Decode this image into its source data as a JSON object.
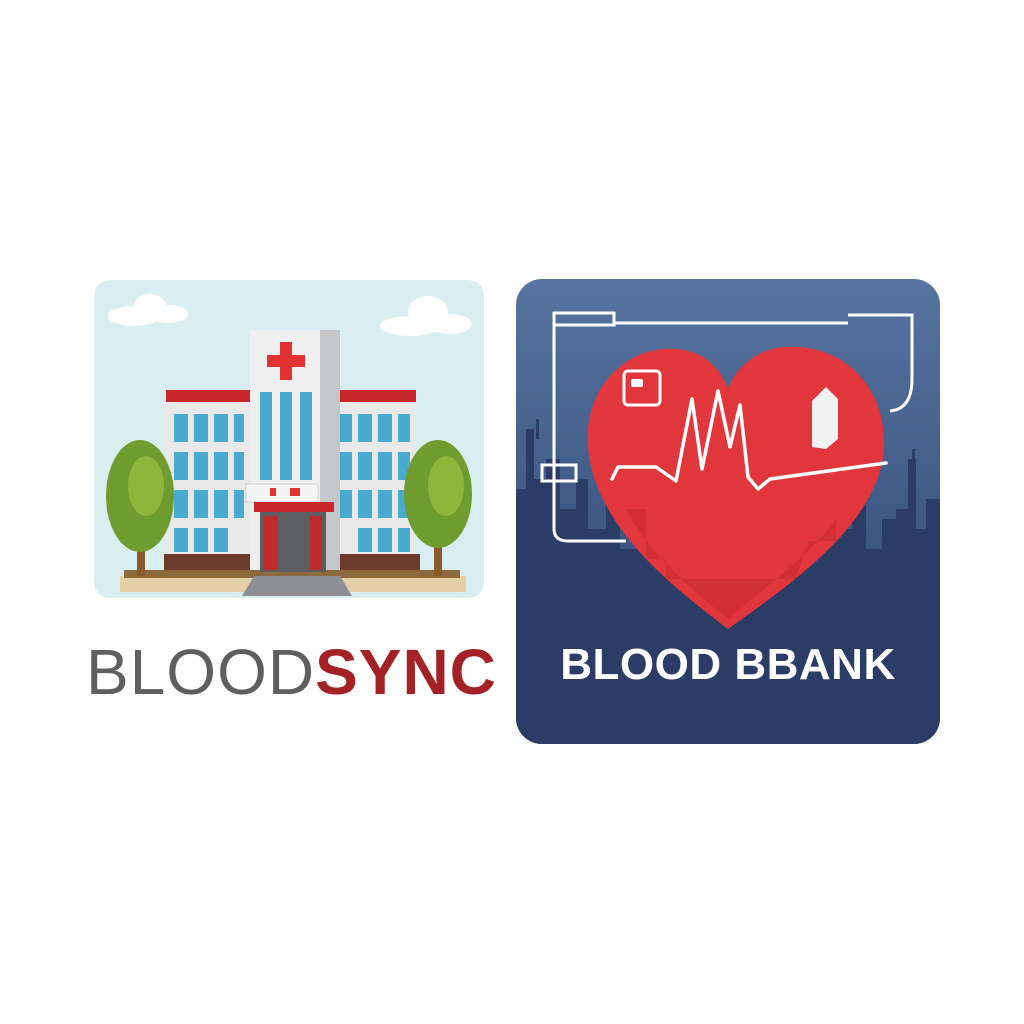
{
  "left_logo": {
    "wordmark_part1": "BLOOD",
    "wordmark_part2": "SYNC",
    "colors": {
      "wordmark_gray": "#5f5f5f",
      "wordmark_red": "#a42226",
      "sky": "#d8eef0",
      "cross": "#e23232"
    },
    "icons": [
      "hospital-building-icon",
      "red-cross-icon",
      "tree-icon",
      "cloud-icon"
    ]
  },
  "right_logo": {
    "wordmark": "BLOOD BBANK",
    "colors": {
      "background_top": "#4f6c9a",
      "background_bottom": "#1e3258",
      "heart": "#e0363c",
      "wordmark": "#ffffff"
    },
    "icons": [
      "heart-icon",
      "heartbeat-line-icon",
      "blood-drop-icon",
      "card-icon",
      "city-skyline-icon"
    ]
  }
}
